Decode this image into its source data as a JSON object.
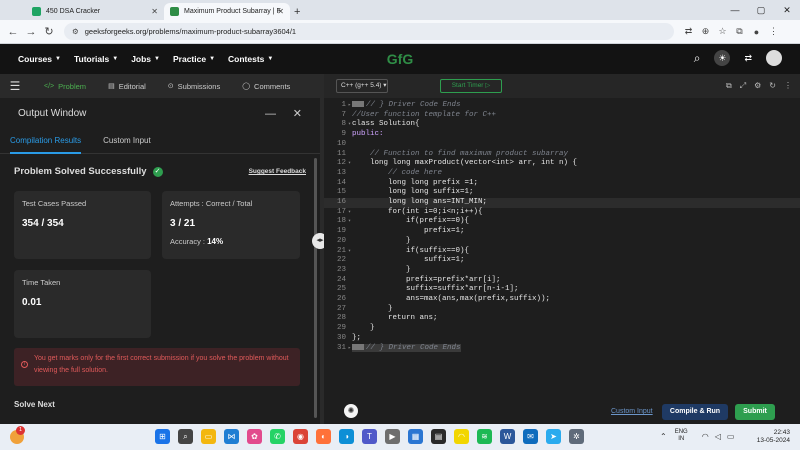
{
  "browser": {
    "tabs": [
      {
        "title": "450 DSA Cracker",
        "favicon_color": "#1fa463",
        "active": false
      },
      {
        "title": "Maximum Product Subarray | F",
        "favicon_color": "#2f8d46",
        "active": true
      }
    ],
    "url": "geeksforgeeks.org/problems/maximum-product-subarray3604/1"
  },
  "header": {
    "menu": [
      "Courses",
      "Tutorials",
      "Jobs",
      "Practice",
      "Contests"
    ],
    "logo": "GfG"
  },
  "problem_tabs": [
    "Problem",
    "Editorial",
    "Submissions",
    "Comments"
  ],
  "output": {
    "title": "Output Window",
    "tabs": [
      "Compilation Results",
      "Custom Input"
    ],
    "status": "Problem Solved Successfully",
    "suggest_feedback": "Suggest Feedback",
    "test_cases_label": "Test Cases Passed",
    "test_cases_value": "354 / 354",
    "attempts_label": "Attempts : Correct / Total",
    "attempts_value": "3 / 21",
    "accuracy_label": "Accuracy :",
    "accuracy_value": "14%",
    "time_label": "Time Taken",
    "time_value": "0.01",
    "notice": "You get marks only for the first correct submission if you solve the problem without viewing the full solution.",
    "solve_next": "Solve Next"
  },
  "editor": {
    "language": "C++ (g++ 5.4)",
    "timer": "Start Timer",
    "lines": [
      {
        "n": "1",
        "text": "// } Driver Code Ends",
        "cls": "cm",
        "marker": true,
        "fold": "▸"
      },
      {
        "n": "7",
        "text": "//User function template for C++",
        "cls": "cm"
      },
      {
        "n": "8",
        "text": "class Solution{",
        "cls": "pl",
        "fold": "▾"
      },
      {
        "n": "9",
        "text": "public:",
        "cls": "kw"
      },
      {
        "n": "10",
        "text": "",
        "cls": "pl"
      },
      {
        "n": "11",
        "text": "    // Function to find maximum product subarray",
        "cls": "cm"
      },
      {
        "n": "12",
        "text": "    long long maxProduct(vector<int> arr, int n) {",
        "cls": "pl",
        "fold": "▾"
      },
      {
        "n": "13",
        "text": "        // code here",
        "cls": "cm"
      },
      {
        "n": "14",
        "text": "        long long prefix =1;",
        "cls": "pl"
      },
      {
        "n": "15",
        "text": "        long long suffix=1;",
        "cls": "pl"
      },
      {
        "n": "16",
        "text": "        long long ans=INT_MIN;",
        "cls": "pl",
        "current": true
      },
      {
        "n": "17",
        "text": "        for(int i=0;i<n;i++){",
        "cls": "pl",
        "fold": "▾"
      },
      {
        "n": "18",
        "text": "            if(prefix==0){",
        "cls": "pl",
        "fold": "▾"
      },
      {
        "n": "19",
        "text": "                prefix=1;",
        "cls": "pl"
      },
      {
        "n": "20",
        "text": "            }",
        "cls": "pl"
      },
      {
        "n": "21",
        "text": "            if(suffix==0){",
        "cls": "pl",
        "fold": "▾"
      },
      {
        "n": "22",
        "text": "                suffix=1;",
        "cls": "pl"
      },
      {
        "n": "23",
        "text": "            }",
        "cls": "pl"
      },
      {
        "n": "24",
        "text": "            prefix=prefix*arr[i];",
        "cls": "pl"
      },
      {
        "n": "25",
        "text": "            suffix=suffix*arr[n-i-1];",
        "cls": "pl"
      },
      {
        "n": "26",
        "text": "            ans=max(ans,max(prefix,suffix));",
        "cls": "pl"
      },
      {
        "n": "27",
        "text": "        }",
        "cls": "pl"
      },
      {
        "n": "28",
        "text": "        return ans;",
        "cls": "pl"
      },
      {
        "n": "29",
        "text": "    }",
        "cls": "pl"
      },
      {
        "n": "30",
        "text": "};",
        "cls": "pl"
      },
      {
        "n": "31",
        "text": "// } Driver Code Ends",
        "cls": "cm",
        "marker": true,
        "fold": "▸",
        "guard": true
      }
    ],
    "custom_input": "Custom Input",
    "compile_run": "Compile & Run",
    "submit": "Submit"
  },
  "taskbar": {
    "notification_count": "1",
    "lang_line1": "ENG",
    "lang_line2": "IN",
    "time": "22:43",
    "date": "13-05-2024",
    "apps": [
      {
        "icon": "windows-start-icon",
        "color": "#1a73e8",
        "glyph": "⊞"
      },
      {
        "icon": "search-icon",
        "color": "#444444",
        "glyph": "⌕"
      },
      {
        "icon": "file-explorer-icon",
        "color": "#f3b70f",
        "glyph": "▭"
      },
      {
        "icon": "vscode-icon",
        "color": "#1f7ed3",
        "glyph": "⋈"
      },
      {
        "icon": "photos-icon",
        "color": "#e24a8d",
        "glyph": "✿"
      },
      {
        "icon": "whatsapp-icon",
        "color": "#25d366",
        "glyph": "✆"
      },
      {
        "icon": "chrome-icon",
        "color": "#db4437",
        "glyph": "◉"
      },
      {
        "icon": "firefox-icon",
        "color": "#ff7139",
        "glyph": "◐"
      },
      {
        "icon": "edge-icon",
        "color": "#0d8fd6",
        "glyph": "◑"
      },
      {
        "icon": "teams-icon",
        "color": "#5059c9",
        "glyph": "T"
      },
      {
        "icon": "media-icon",
        "color": "#6e6e6e",
        "glyph": "▶"
      },
      {
        "icon": "store-icon",
        "color": "#2b76d2",
        "glyph": "▦"
      },
      {
        "icon": "news-icon",
        "color": "#2a2a2a",
        "glyph": "▤"
      },
      {
        "icon": "snapchat-icon",
        "color": "#f2d600",
        "glyph": "◠"
      },
      {
        "icon": "spotify-icon",
        "color": "#1db954",
        "glyph": "≋"
      },
      {
        "icon": "word-icon",
        "color": "#2b579a",
        "glyph": "W"
      },
      {
        "icon": "mail-icon",
        "color": "#0f6cbd",
        "glyph": "✉"
      },
      {
        "icon": "telegram-icon",
        "color": "#2aabee",
        "glyph": "➤"
      },
      {
        "icon": "settings-icon",
        "color": "#5f6b7a",
        "glyph": "✲"
      }
    ]
  }
}
